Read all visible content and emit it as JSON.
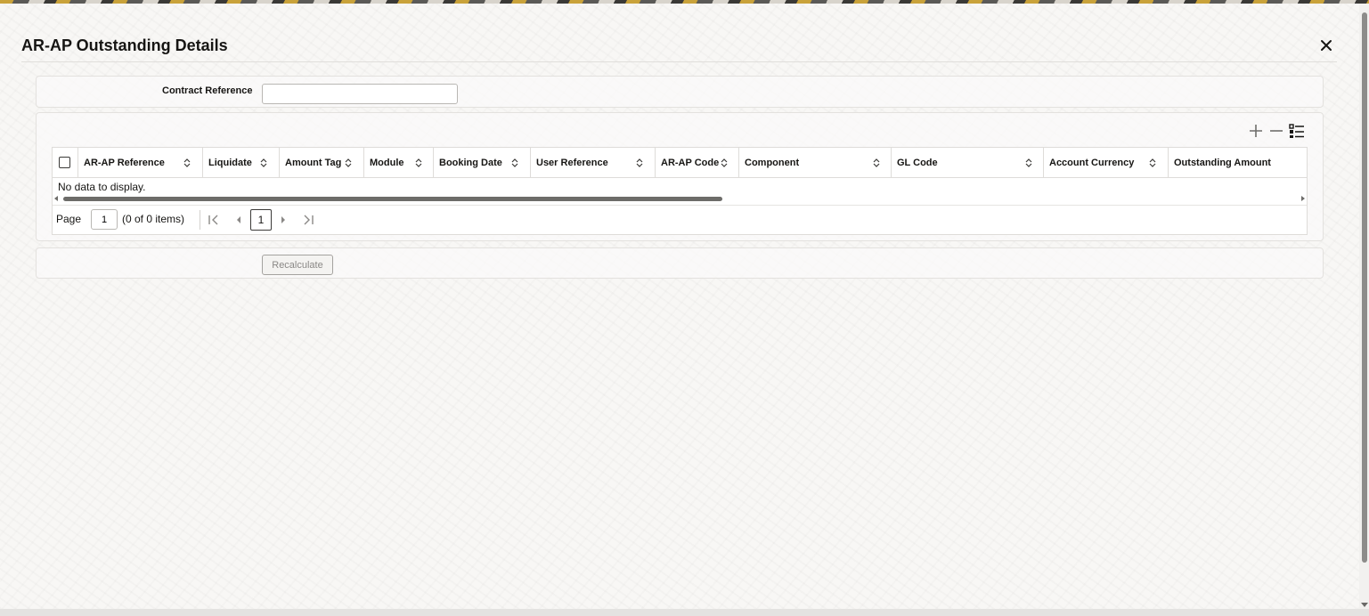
{
  "dialog": {
    "title": "AR-AP Outstanding Details",
    "close_label": "✕"
  },
  "form": {
    "contract_reference_label": "Contract Reference",
    "contract_reference_value": ""
  },
  "toolbar": {
    "add_icon": "plus-icon",
    "remove_icon": "minus-icon",
    "view_icon": "list-view-icon"
  },
  "grid": {
    "columns": [
      "AR-AP Reference",
      "Liquidate",
      "Amount Tag",
      "Module",
      "Booking Date",
      "User Reference",
      "AR-AP Code",
      "Component",
      "GL Code",
      "Account Currency",
      "Outstanding Amount"
    ],
    "rows": [],
    "empty_message": "No data to display."
  },
  "pager": {
    "page_label": "Page",
    "page_value": "1",
    "items_text": "(0 of 0 items)",
    "current_page": "1"
  },
  "actions": {
    "recalculate_label": "Recalculate"
  }
}
